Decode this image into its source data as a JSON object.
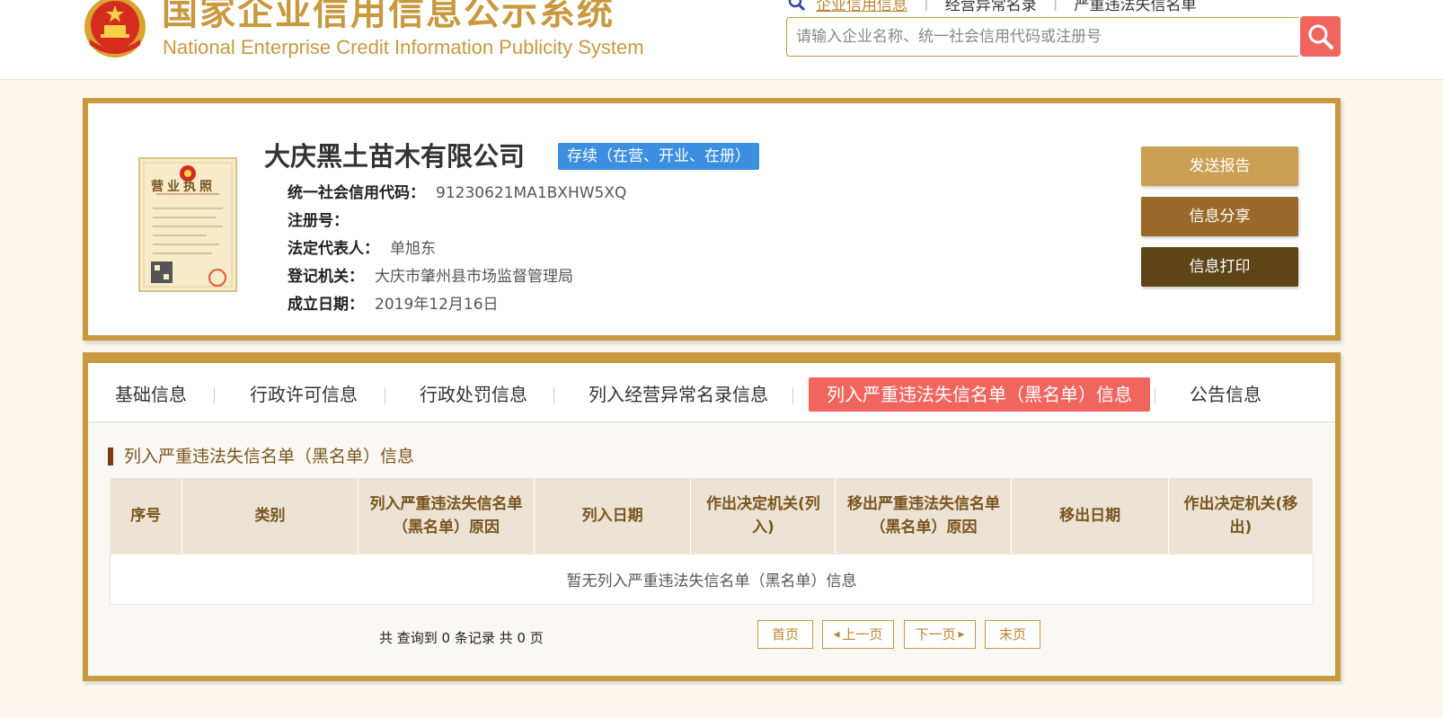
{
  "header": {
    "title_cn": "国家企业信用信息公示系统",
    "title_en": "National Enterprise Credit Information Publicity System",
    "search_tabs": [
      "企业信用信息",
      "经营异常名录",
      "严重违法失信名单"
    ],
    "search_placeholder": "请输入企业名称、统一社会信用代码或注册号"
  },
  "company": {
    "name": "大庆黑土苗木有限公司",
    "status": "存续（在营、开业、在册）",
    "fields": [
      {
        "label": "统一社会信用代码：",
        "value": "91230621MA1BXHW5XQ"
      },
      {
        "label": "注册号：",
        "value": ""
      },
      {
        "label": "法定代表人：",
        "value": "单旭东"
      },
      {
        "label": "登记机关：",
        "value": "大庆市肇州县市场监督管理局"
      },
      {
        "label": "成立日期：",
        "value": "2019年12月16日"
      }
    ],
    "license_label": "营业执照",
    "actions": [
      "发送报告",
      "信息分享",
      "信息打印"
    ]
  },
  "tabs": [
    "基础信息",
    "行政许可信息",
    "行政处罚信息",
    "列入经营异常名录信息",
    "列入严重违法失信名单（黑名单）信息",
    "公告信息"
  ],
  "active_tab": 4,
  "section": {
    "title": "列入严重违法失信名单（黑名单）信息",
    "columns": [
      "序号",
      "类别",
      "列入严重违法失信名单（黑名单）原因",
      "列入日期",
      "作出决定机关(列入)",
      "移出严重违法失信名单（黑名单）原因",
      "移出日期",
      "作出决定机关(移出)"
    ],
    "empty_text": "暂无列入严重违法失信名单（黑名单）信息"
  },
  "pager": {
    "summary": "共 查询到 0 条记录 共 0 页",
    "first": "首页",
    "prev": "上一页",
    "next": "下一页",
    "last": "末页"
  },
  "colors": {
    "gold": "#c8993e",
    "red": "#f0665e",
    "blue": "#3c8fe0",
    "brown_mid": "#9b6a2a",
    "brown_dark": "#5e4518"
  }
}
